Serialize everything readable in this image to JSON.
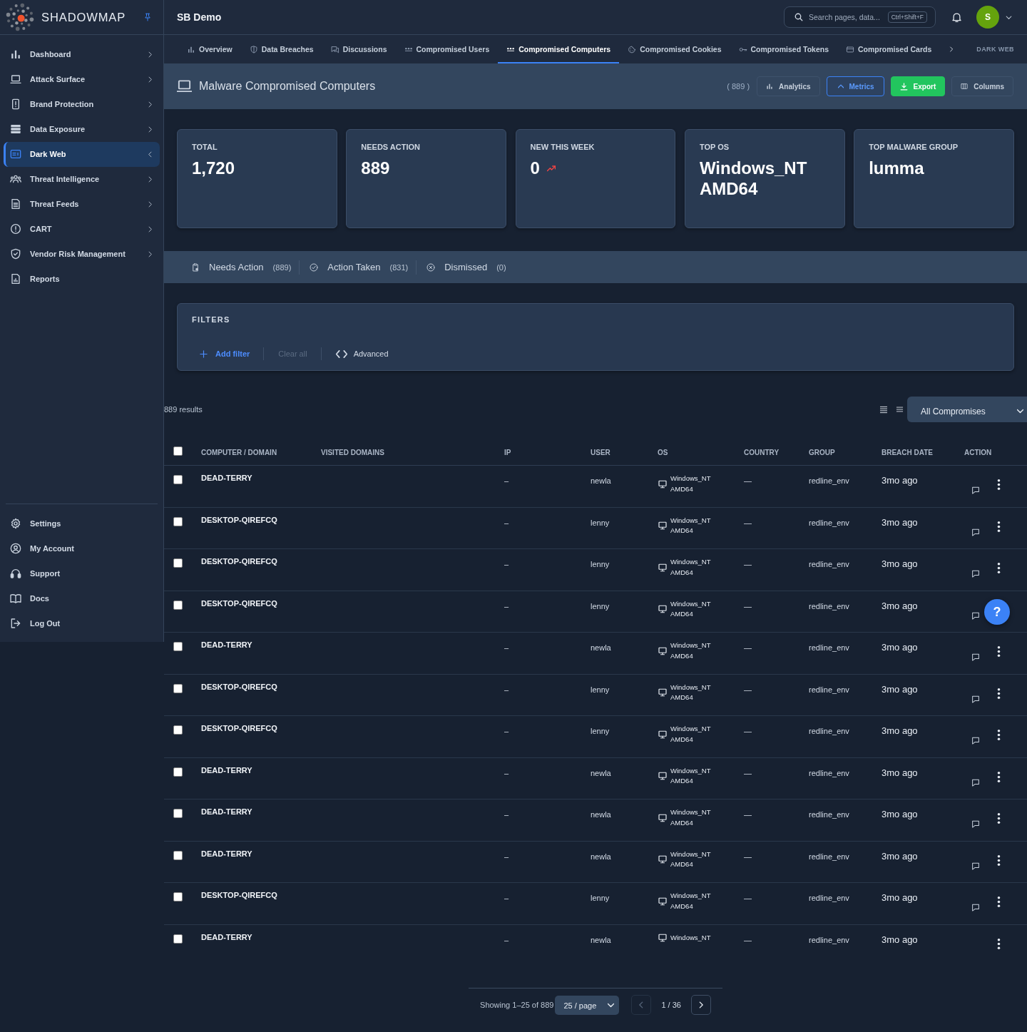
{
  "sidebar": {
    "brand": "SHADOWMAP",
    "items": [
      {
        "label": "Dashboard",
        "kind": "group",
        "expanded": false,
        "selected": false
      },
      {
        "label": "Attack Surface",
        "kind": "group",
        "expanded": false,
        "selected": false
      },
      {
        "label": "Brand Protection",
        "kind": "group",
        "expanded": false,
        "selected": false
      },
      {
        "label": "Data Exposure",
        "kind": "group",
        "expanded": false,
        "selected": false
      },
      {
        "label": "Dark Web",
        "kind": "group",
        "expanded": true,
        "selected": true
      },
      {
        "label": "Threat Intelligence",
        "kind": "group",
        "expanded": false,
        "selected": false
      },
      {
        "label": "Threat Feeds",
        "kind": "group",
        "expanded": false,
        "selected": false
      },
      {
        "label": "CART",
        "kind": "group",
        "expanded": false,
        "selected": false
      },
      {
        "label": "Vendor Risk Management",
        "kind": "group",
        "expanded": false,
        "selected": false
      },
      {
        "label": "Reports",
        "kind": "link",
        "selected": false
      }
    ],
    "footer_items": [
      "Settings",
      "My Account",
      "Support",
      "Docs",
      "Log Out"
    ]
  },
  "header": {
    "workspace": "SB Demo",
    "search": {
      "placeholder": "Search pages, data...",
      "shortcut": "Ctrl+Shift+F"
    },
    "avatar": "S"
  },
  "tabs": {
    "items": [
      {
        "label": "Overview",
        "selected": false
      },
      {
        "label": "Data Breaches",
        "selected": false
      },
      {
        "label": "Discussions",
        "selected": false
      },
      {
        "label": "Compromised Users",
        "selected": false
      },
      {
        "label": "Compromised Computers",
        "selected": true
      },
      {
        "label": "Compromised Cookies",
        "selected": false
      },
      {
        "label": "Compromised Tokens",
        "selected": false
      },
      {
        "label": "Compromised Cards",
        "selected": false
      }
    ],
    "section": "DARK WEB"
  },
  "page_header": {
    "title": "Malware Compromised Computers",
    "count": "( 889 )",
    "buttons": [
      {
        "label": "Analytics",
        "kind": "plain"
      },
      {
        "label": "Metrics",
        "kind": "toggle",
        "on": true
      },
      {
        "label": "Export",
        "kind": "primary"
      },
      {
        "label": "Columns",
        "kind": "plain"
      }
    ]
  },
  "metrics": [
    {
      "label": "TOTAL",
      "value": "1,720",
      "trend_up": false
    },
    {
      "label": "NEEDS ACTION",
      "value": "889",
      "trend_up": false
    },
    {
      "label": "NEW THIS WEEK",
      "value": "0",
      "trend_up": true
    },
    {
      "label": "TOP OS",
      "value": "Windows_NT AMD64",
      "trend_up": false
    },
    {
      "label": "TOP MALWARE GROUP",
      "value": "lumma",
      "trend_up": false
    }
  ],
  "status_tabs": [
    {
      "label": "Needs Action",
      "count": "(889)"
    },
    {
      "label": "Action Taken",
      "count": "(831)"
    },
    {
      "label": "Dismissed",
      "count": "(0)"
    }
  ],
  "filters": {
    "title": "FILTERS",
    "add_label": "Add filter",
    "clear": {
      "label": "Clear all",
      "disabled": true
    },
    "advanced_label": "Advanced"
  },
  "results": {
    "count": "889 results",
    "view_filter": "All Compromises"
  },
  "table": {
    "select_all_checked": false,
    "columns": [
      "COMPUTER / DOMAIN",
      "VISITED DOMAINS",
      "IP",
      "USER",
      "OS",
      "COUNTRY",
      "GROUP",
      "BREACH DATE",
      "ACTION"
    ],
    "rows": [
      {
        "checked": false,
        "computer": "DEAD-TERRY",
        "ip": "–",
        "user": "newla",
        "os": [
          "Windows_NT",
          "AMD64"
        ],
        "country": "—",
        "group": "redline_env",
        "breach_date": "3mo ago",
        "actions": [
          {
            "kind": "comment"
          },
          {
            "kind": "menu"
          }
        ]
      },
      {
        "checked": false,
        "computer": "DESKTOP-QIREFCQ",
        "ip": "–",
        "user": "lenny",
        "os": [
          "Windows_NT",
          "AMD64"
        ],
        "country": "—",
        "group": "redline_env",
        "breach_date": "3mo ago",
        "actions": [
          {
            "kind": "comment"
          },
          {
            "kind": "menu"
          }
        ]
      },
      {
        "checked": false,
        "computer": "DESKTOP-QIREFCQ",
        "ip": "–",
        "user": "lenny",
        "os": [
          "Windows_NT",
          "AMD64"
        ],
        "country": "—",
        "group": "redline_env",
        "breach_date": "3mo ago",
        "actions": [
          {
            "kind": "comment"
          },
          {
            "kind": "menu"
          }
        ]
      },
      {
        "checked": false,
        "computer": "DESKTOP-QIREFCQ",
        "ip": "–",
        "user": "lenny",
        "os": [
          "Windows_NT",
          "AMD64"
        ],
        "country": "—",
        "group": "redline_env",
        "breach_date": "3mo ago",
        "actions": [
          {
            "kind": "comment"
          }
        ]
      },
      {
        "checked": false,
        "computer": "DEAD-TERRY",
        "ip": "–",
        "user": "newla",
        "os": [
          "Windows_NT",
          "AMD64"
        ],
        "country": "—",
        "group": "redline_env",
        "breach_date": "3mo ago",
        "actions": [
          {
            "kind": "comment"
          },
          {
            "kind": "menu"
          }
        ]
      },
      {
        "checked": false,
        "computer": "DESKTOP-QIREFCQ",
        "ip": "–",
        "user": "lenny",
        "os": [
          "Windows_NT",
          "AMD64"
        ],
        "country": "—",
        "group": "redline_env",
        "breach_date": "3mo ago",
        "actions": [
          {
            "kind": "comment"
          },
          {
            "kind": "menu"
          }
        ]
      },
      {
        "checked": false,
        "computer": "DESKTOP-QIREFCQ",
        "ip": "–",
        "user": "lenny",
        "os": [
          "Windows_NT",
          "AMD64"
        ],
        "country": "—",
        "group": "redline_env",
        "breach_date": "3mo ago",
        "actions": [
          {
            "kind": "comment"
          },
          {
            "kind": "menu"
          }
        ]
      },
      {
        "checked": false,
        "computer": "DEAD-TERRY",
        "ip": "–",
        "user": "newla",
        "os": [
          "Windows_NT",
          "AMD64"
        ],
        "country": "—",
        "group": "redline_env",
        "breach_date": "3mo ago",
        "actions": [
          {
            "kind": "comment"
          },
          {
            "kind": "menu"
          }
        ]
      },
      {
        "checked": false,
        "computer": "DEAD-TERRY",
        "ip": "–",
        "user": "newla",
        "os": [
          "Windows_NT",
          "AMD64"
        ],
        "country": "—",
        "group": "redline_env",
        "breach_date": "3mo ago",
        "actions": [
          {
            "kind": "comment"
          },
          {
            "kind": "menu"
          }
        ]
      },
      {
        "checked": false,
        "computer": "DEAD-TERRY",
        "ip": "–",
        "user": "newla",
        "os": [
          "Windows_NT",
          "AMD64"
        ],
        "country": "—",
        "group": "redline_env",
        "breach_date": "3mo ago",
        "actions": [
          {
            "kind": "comment"
          },
          {
            "kind": "menu"
          }
        ]
      },
      {
        "checked": false,
        "computer": "DESKTOP-QIREFCQ",
        "ip": "–",
        "user": "lenny",
        "os": [
          "Windows_NT",
          "AMD64"
        ],
        "country": "—",
        "group": "redline_env",
        "breach_date": "3mo ago",
        "actions": [
          {
            "kind": "comment"
          },
          {
            "kind": "menu"
          }
        ]
      },
      {
        "checked": false,
        "computer": "DEAD-TERRY",
        "ip": "–",
        "user": "newla",
        "os": [
          "Windows_NT"
        ],
        "country": "—",
        "group": "redline_env",
        "breach_date": "3mo ago",
        "actions": [
          {
            "kind": "menu"
          }
        ]
      }
    ]
  },
  "pagination": {
    "summary": "Showing 1–25 of 889",
    "page_size": "25 / page",
    "page": "1 / 36",
    "prev_disabled": true
  },
  "help": "?"
}
